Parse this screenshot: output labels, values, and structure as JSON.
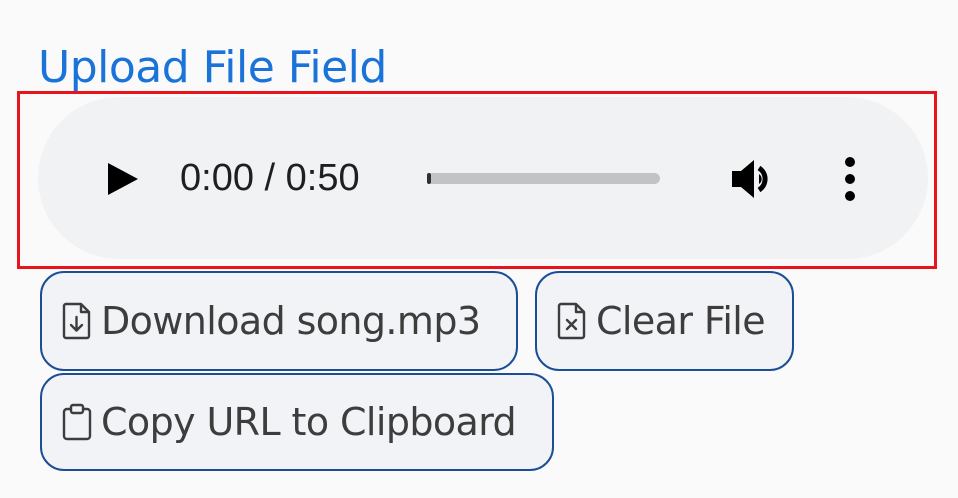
{
  "field": {
    "label": "Upload File Field"
  },
  "audio_player": {
    "current_time": "0:00",
    "separator": " / ",
    "duration": "0:50",
    "progress_fraction": 0.01,
    "play_icon": "play-icon",
    "volume_icon": "volume-icon",
    "menu_icon": "more-vertical-icon"
  },
  "buttons": {
    "download": {
      "label": "Download song.mp3",
      "icon": "file-download-icon"
    },
    "clear": {
      "label": "Clear File",
      "icon": "file-x-icon"
    },
    "copy": {
      "label": "Copy URL to Clipboard",
      "icon": "clipboard-icon"
    }
  },
  "colors": {
    "label": "#1a73d9",
    "highlight": "#e8141c",
    "button_border": "#1c4e96",
    "player_bg": "#f1f2f4"
  }
}
